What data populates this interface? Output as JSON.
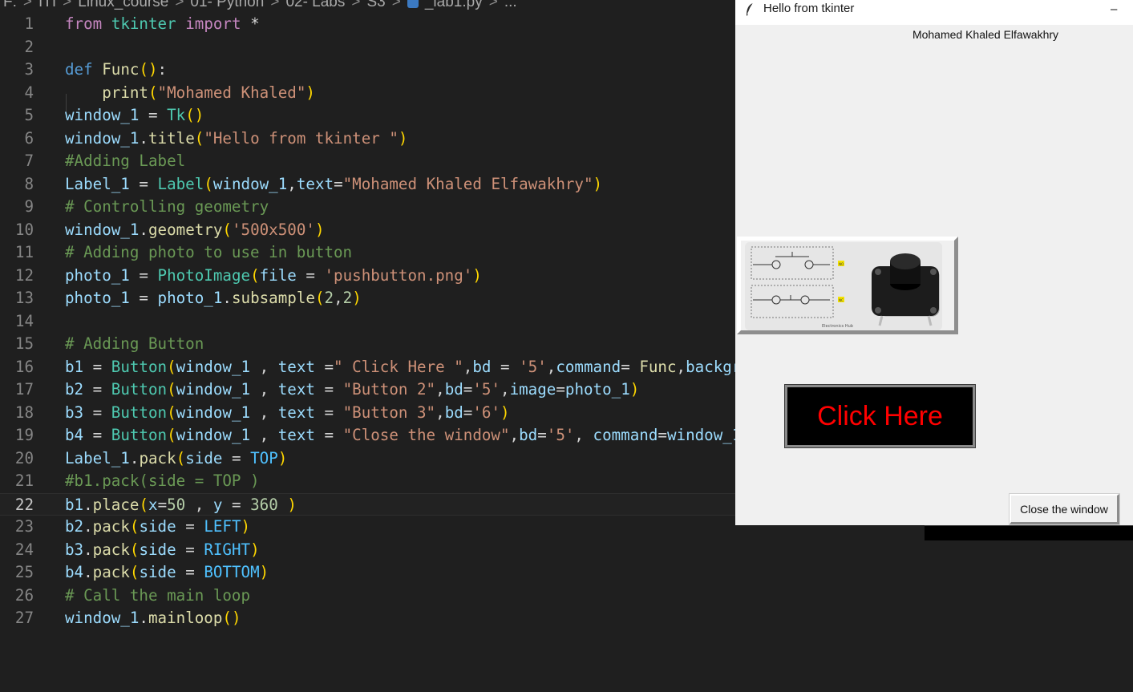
{
  "breadcrumb": {
    "items": [
      "F:",
      "ITI",
      "Linux_course",
      "01- Python",
      "02- Labs",
      "S3",
      "_lab1.py",
      "..."
    ],
    "separator": ">"
  },
  "editor": {
    "current_line": 22,
    "lines": [
      {
        "n": "1",
        "tokens": [
          [
            "kw",
            "from"
          ],
          [
            "op",
            " "
          ],
          [
            "cls",
            "tkinter"
          ],
          [
            "op",
            " "
          ],
          [
            "kw",
            "import"
          ],
          [
            "op",
            " *"
          ]
        ]
      },
      {
        "n": "2",
        "tokens": []
      },
      {
        "n": "3",
        "tokens": [
          [
            "def",
            "def"
          ],
          [
            "op",
            " "
          ],
          [
            "fn",
            "Func"
          ],
          [
            "p1",
            "()"
          ],
          [
            "op",
            ":"
          ]
        ]
      },
      {
        "n": "4",
        "tokens": [
          [
            "op",
            "    "
          ],
          [
            "fn",
            "print"
          ],
          [
            "p1",
            "("
          ],
          [
            "str",
            "\"Mohamed Khaled\""
          ],
          [
            "p1",
            ")"
          ]
        ]
      },
      {
        "n": "5",
        "tokens": [
          [
            "var",
            "window_1"
          ],
          [
            "op",
            " = "
          ],
          [
            "cls",
            "Tk"
          ],
          [
            "p1",
            "()"
          ]
        ]
      },
      {
        "n": "6",
        "tokens": [
          [
            "var",
            "window_1"
          ],
          [
            "op",
            "."
          ],
          [
            "fn",
            "title"
          ],
          [
            "p1",
            "("
          ],
          [
            "str",
            "\"Hello from tkinter \""
          ],
          [
            "p1",
            ")"
          ]
        ]
      },
      {
        "n": "7",
        "tokens": [
          [
            "cmt",
            "#Adding Label"
          ]
        ]
      },
      {
        "n": "8",
        "tokens": [
          [
            "var",
            "Label_1"
          ],
          [
            "op",
            " = "
          ],
          [
            "cls",
            "Label"
          ],
          [
            "p1",
            "("
          ],
          [
            "var",
            "window_1"
          ],
          [
            "op",
            ","
          ],
          [
            "var",
            "text"
          ],
          [
            "op",
            "="
          ],
          [
            "str",
            "\"Mohamed Khaled Elfawakhry\""
          ],
          [
            "p1",
            ")"
          ]
        ]
      },
      {
        "n": "9",
        "tokens": [
          [
            "cmt",
            "# Controlling geometry"
          ]
        ]
      },
      {
        "n": "10",
        "tokens": [
          [
            "var",
            "window_1"
          ],
          [
            "op",
            "."
          ],
          [
            "fn",
            "geometry"
          ],
          [
            "p1",
            "("
          ],
          [
            "str",
            "'500x500'"
          ],
          [
            "p1",
            ")"
          ]
        ]
      },
      {
        "n": "11",
        "tokens": [
          [
            "cmt",
            "# Adding photo to use in button"
          ]
        ]
      },
      {
        "n": "12",
        "tokens": [
          [
            "var",
            "photo_1"
          ],
          [
            "op",
            " = "
          ],
          [
            "cls",
            "PhotoImage"
          ],
          [
            "p1",
            "("
          ],
          [
            "var",
            "file"
          ],
          [
            "op",
            " = "
          ],
          [
            "str",
            "'pushbutton.png'"
          ],
          [
            "p1",
            ")"
          ]
        ]
      },
      {
        "n": "13",
        "tokens": [
          [
            "var",
            "photo_1"
          ],
          [
            "op",
            " = "
          ],
          [
            "var",
            "photo_1"
          ],
          [
            "op",
            "."
          ],
          [
            "fn",
            "subsample"
          ],
          [
            "p1",
            "("
          ],
          [
            "num",
            "2"
          ],
          [
            "op",
            ","
          ],
          [
            "num",
            "2"
          ],
          [
            "p1",
            ")"
          ]
        ]
      },
      {
        "n": "14",
        "tokens": []
      },
      {
        "n": "15",
        "tokens": [
          [
            "cmt",
            "# Adding Button"
          ]
        ]
      },
      {
        "n": "16",
        "tokens": [
          [
            "var",
            "b1"
          ],
          [
            "op",
            " = "
          ],
          [
            "cls",
            "Button"
          ],
          [
            "p1",
            "("
          ],
          [
            "var",
            "window_1"
          ],
          [
            "op",
            " , "
          ],
          [
            "var",
            "text"
          ],
          [
            "op",
            " ="
          ],
          [
            "str",
            "\" Click Here \""
          ],
          [
            "op",
            ","
          ],
          [
            "var",
            "bd"
          ],
          [
            "op",
            " = "
          ],
          [
            "str",
            "'5'"
          ],
          [
            "op",
            ","
          ],
          [
            "var",
            "command"
          ],
          [
            "op",
            "= "
          ],
          [
            "fn",
            "Func"
          ],
          [
            "op",
            ","
          ],
          [
            "var",
            "backgr"
          ]
        ]
      },
      {
        "n": "17",
        "tokens": [
          [
            "var",
            "b2"
          ],
          [
            "op",
            " = "
          ],
          [
            "cls",
            "Button"
          ],
          [
            "p1",
            "("
          ],
          [
            "var",
            "window_1"
          ],
          [
            "op",
            " , "
          ],
          [
            "var",
            "text"
          ],
          [
            "op",
            " = "
          ],
          [
            "str",
            "\"Button 2\""
          ],
          [
            "op",
            ","
          ],
          [
            "var",
            "bd"
          ],
          [
            "op",
            "="
          ],
          [
            "str",
            "'5'"
          ],
          [
            "op",
            ","
          ],
          [
            "var",
            "image"
          ],
          [
            "op",
            "="
          ],
          [
            "var",
            "photo_1"
          ],
          [
            "p1",
            ")"
          ]
        ]
      },
      {
        "n": "18",
        "tokens": [
          [
            "var",
            "b3"
          ],
          [
            "op",
            " = "
          ],
          [
            "cls",
            "Button"
          ],
          [
            "p1",
            "("
          ],
          [
            "var",
            "window_1"
          ],
          [
            "op",
            " , "
          ],
          [
            "var",
            "text"
          ],
          [
            "op",
            " = "
          ],
          [
            "str",
            "\"Button 3\""
          ],
          [
            "op",
            ","
          ],
          [
            "var",
            "bd"
          ],
          [
            "op",
            "="
          ],
          [
            "str",
            "'6'"
          ],
          [
            "p1",
            ")"
          ]
        ]
      },
      {
        "n": "19",
        "tokens": [
          [
            "var",
            "b4"
          ],
          [
            "op",
            " = "
          ],
          [
            "cls",
            "Button"
          ],
          [
            "p1",
            "("
          ],
          [
            "var",
            "window_1"
          ],
          [
            "op",
            " , "
          ],
          [
            "var",
            "text"
          ],
          [
            "op",
            " = "
          ],
          [
            "str",
            "\"Close the window\""
          ],
          [
            "op",
            ","
          ],
          [
            "var",
            "bd"
          ],
          [
            "op",
            "="
          ],
          [
            "str",
            "'5'"
          ],
          [
            "op",
            ", "
          ],
          [
            "var",
            "command"
          ],
          [
            "op",
            "="
          ],
          [
            "var",
            "window_1"
          ]
        ]
      },
      {
        "n": "20",
        "tokens": [
          [
            "var",
            "Label_1"
          ],
          [
            "op",
            "."
          ],
          [
            "fn",
            "pack"
          ],
          [
            "p1",
            "("
          ],
          [
            "var",
            "side"
          ],
          [
            "op",
            " = "
          ],
          [
            "const",
            "TOP"
          ],
          [
            "p1",
            ")"
          ]
        ]
      },
      {
        "n": "21",
        "tokens": [
          [
            "cmt",
            "#b1.pack(side = TOP )"
          ]
        ]
      },
      {
        "n": "22",
        "tokens": [
          [
            "var",
            "b1"
          ],
          [
            "op",
            "."
          ],
          [
            "fn",
            "place"
          ],
          [
            "p1",
            "("
          ],
          [
            "var",
            "x"
          ],
          [
            "op",
            "="
          ],
          [
            "num",
            "50"
          ],
          [
            "op",
            " , "
          ],
          [
            "var",
            "y"
          ],
          [
            "op",
            " = "
          ],
          [
            "num",
            "360"
          ],
          [
            "op",
            " "
          ],
          [
            "p1",
            ")"
          ]
        ]
      },
      {
        "n": "23",
        "tokens": [
          [
            "var",
            "b2"
          ],
          [
            "op",
            "."
          ],
          [
            "fn",
            "pack"
          ],
          [
            "p1",
            "("
          ],
          [
            "var",
            "side"
          ],
          [
            "op",
            " = "
          ],
          [
            "const",
            "LEFT"
          ],
          [
            "p1",
            ")"
          ]
        ]
      },
      {
        "n": "24",
        "tokens": [
          [
            "var",
            "b3"
          ],
          [
            "op",
            "."
          ],
          [
            "fn",
            "pack"
          ],
          [
            "p1",
            "("
          ],
          [
            "var",
            "side"
          ],
          [
            "op",
            " = "
          ],
          [
            "const",
            "RIGHT"
          ],
          [
            "p1",
            ")"
          ]
        ]
      },
      {
        "n": "25",
        "tokens": [
          [
            "var",
            "b4"
          ],
          [
            "op",
            "."
          ],
          [
            "fn",
            "pack"
          ],
          [
            "p1",
            "("
          ],
          [
            "var",
            "side"
          ],
          [
            "op",
            " = "
          ],
          [
            "const",
            "BOTTOM"
          ],
          [
            "p1",
            ")"
          ]
        ]
      },
      {
        "n": "26",
        "tokens": [
          [
            "cmt",
            "# Call the main loop"
          ]
        ]
      },
      {
        "n": "27",
        "tokens": [
          [
            "var",
            "window_1"
          ],
          [
            "op",
            "."
          ],
          [
            "fn",
            "mainloop"
          ],
          [
            "p1",
            "()"
          ]
        ]
      }
    ]
  },
  "tk_window": {
    "title": "Hello from tkinter",
    "minimize_glyph": "–",
    "label": "Mohamed Khaled Elfawakhry",
    "image_button": {
      "badge_no": "NO",
      "badge_nc": "NC",
      "watermark": "Electronics Hub"
    },
    "click_button": {
      "label": "Click Here",
      "bg": "#000000",
      "fg": "#ff0000"
    },
    "close_button": {
      "label": "Close the window"
    }
  }
}
